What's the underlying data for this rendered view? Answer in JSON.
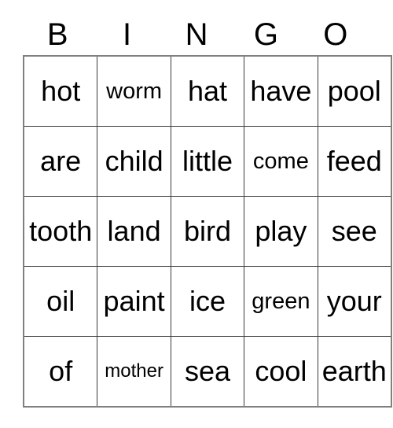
{
  "card": {
    "headers": [
      "B",
      "I",
      "N",
      "G",
      "O"
    ],
    "rows": [
      [
        {
          "word": "hot",
          "size": "lg"
        },
        {
          "word": "worm",
          "size": "md"
        },
        {
          "word": "hat",
          "size": "lg"
        },
        {
          "word": "have",
          "size": "lg"
        },
        {
          "word": "pool",
          "size": "lg"
        }
      ],
      [
        {
          "word": "are",
          "size": "lg"
        },
        {
          "word": "child",
          "size": "lg"
        },
        {
          "word": "little",
          "size": "lg"
        },
        {
          "word": "come",
          "size": "md"
        },
        {
          "word": "feed",
          "size": "lg"
        }
      ],
      [
        {
          "word": "tooth",
          "size": "lg"
        },
        {
          "word": "land",
          "size": "lg"
        },
        {
          "word": "bird",
          "size": "lg"
        },
        {
          "word": "play",
          "size": "lg"
        },
        {
          "word": "see",
          "size": "lg"
        }
      ],
      [
        {
          "word": "oil",
          "size": "lg"
        },
        {
          "word": "paint",
          "size": "lg"
        },
        {
          "word": "ice",
          "size": "lg"
        },
        {
          "word": "green",
          "size": "md"
        },
        {
          "word": "your",
          "size": "lg"
        }
      ],
      [
        {
          "word": "of",
          "size": "lg"
        },
        {
          "word": "mother",
          "size": "sm"
        },
        {
          "word": "sea",
          "size": "lg"
        },
        {
          "word": "cool",
          "size": "lg"
        },
        {
          "word": "earth",
          "size": "lg"
        }
      ]
    ]
  },
  "colors": {
    "background": "#ffffff",
    "text": "#000000",
    "outer_border": "#808080",
    "inner_border": "#3a3a3a"
  }
}
